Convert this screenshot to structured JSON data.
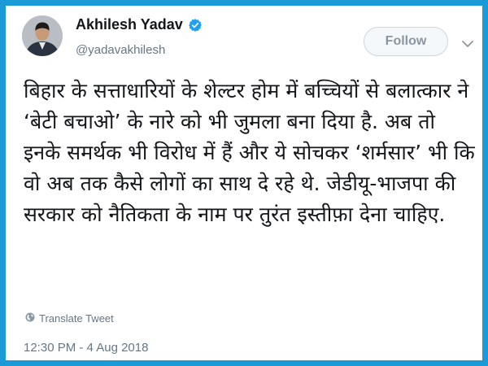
{
  "author": {
    "name": "Akhilesh Yadav",
    "handle": "@yadavakhilesh",
    "verified_color": "#1da1f2"
  },
  "actions": {
    "follow_label": "Follow",
    "more_icon": "chevron-down-icon"
  },
  "tweet": {
    "text": "बिहार के सत्ताधारियों के शेल्टर होम में बच्चियों से बलात्कार ने ‘बेटी बचाओ’ के नारे को भी जुमला बना दिया है. अब तो इनके समर्थक भी विरोध में हैं और ये सोचकर ‘शर्मसार’ भी कि वो अब तक कैसे लोगों का साथ दे रहे थे. जेडीयू-भाजपा की सरकार को नैतिकता के नाम पर तुरंत इस्तीफ़ा देना चाहिए."
  },
  "translate": {
    "label": "Translate Tweet",
    "icon": "globe-icon"
  },
  "timestamp": "12:30 PM - 4 Aug 2018",
  "colors": {
    "frame": "#1a9bd7",
    "text": "#14171a",
    "muted": "#657786"
  }
}
